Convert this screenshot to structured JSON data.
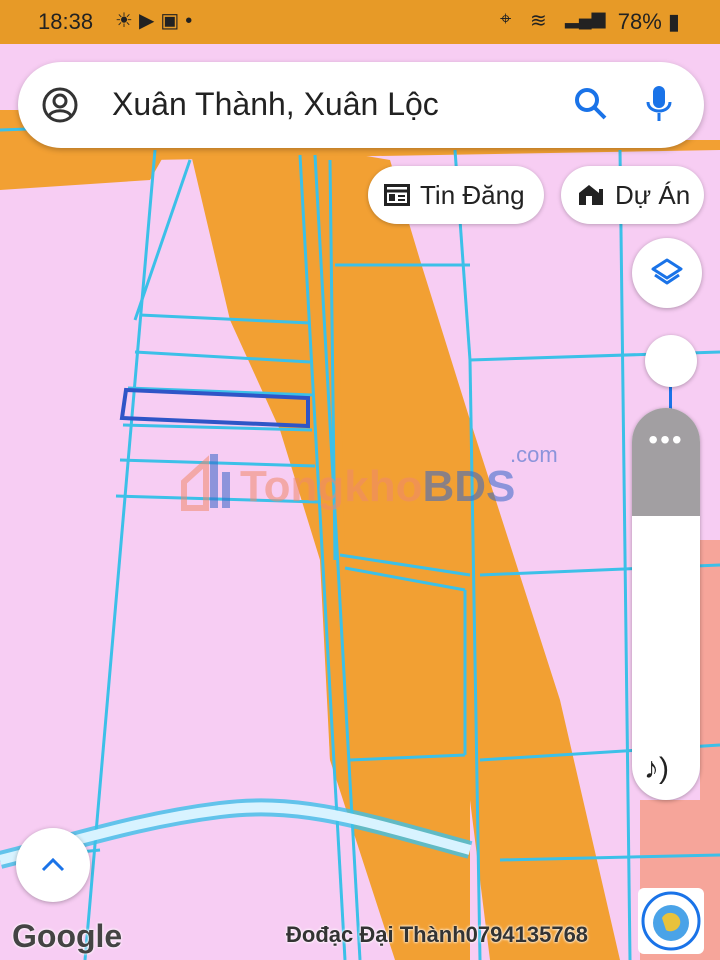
{
  "status_bar": {
    "time": "18:38",
    "battery": "78%"
  },
  "search": {
    "query": "Xuân Thành, Xuân Lộc"
  },
  "chips": {
    "listings": "Tin Đăng",
    "projects": "Dự Án"
  },
  "side_panel": {
    "more": "•••"
  },
  "map": {
    "attribution": "Google",
    "credit": "Đođạc Đại Thành0794135768",
    "colors": {
      "residential": "#f7cdf3",
      "road_zone": "#f2a033",
      "parcel_line": "#3cc0e8",
      "highlight_parcel": "#2f55c7",
      "status_bar": "#e79a27"
    }
  },
  "watermark": {
    "brand_a": "Tongkho",
    "brand_b": "BDS",
    "suffix": ".com"
  }
}
